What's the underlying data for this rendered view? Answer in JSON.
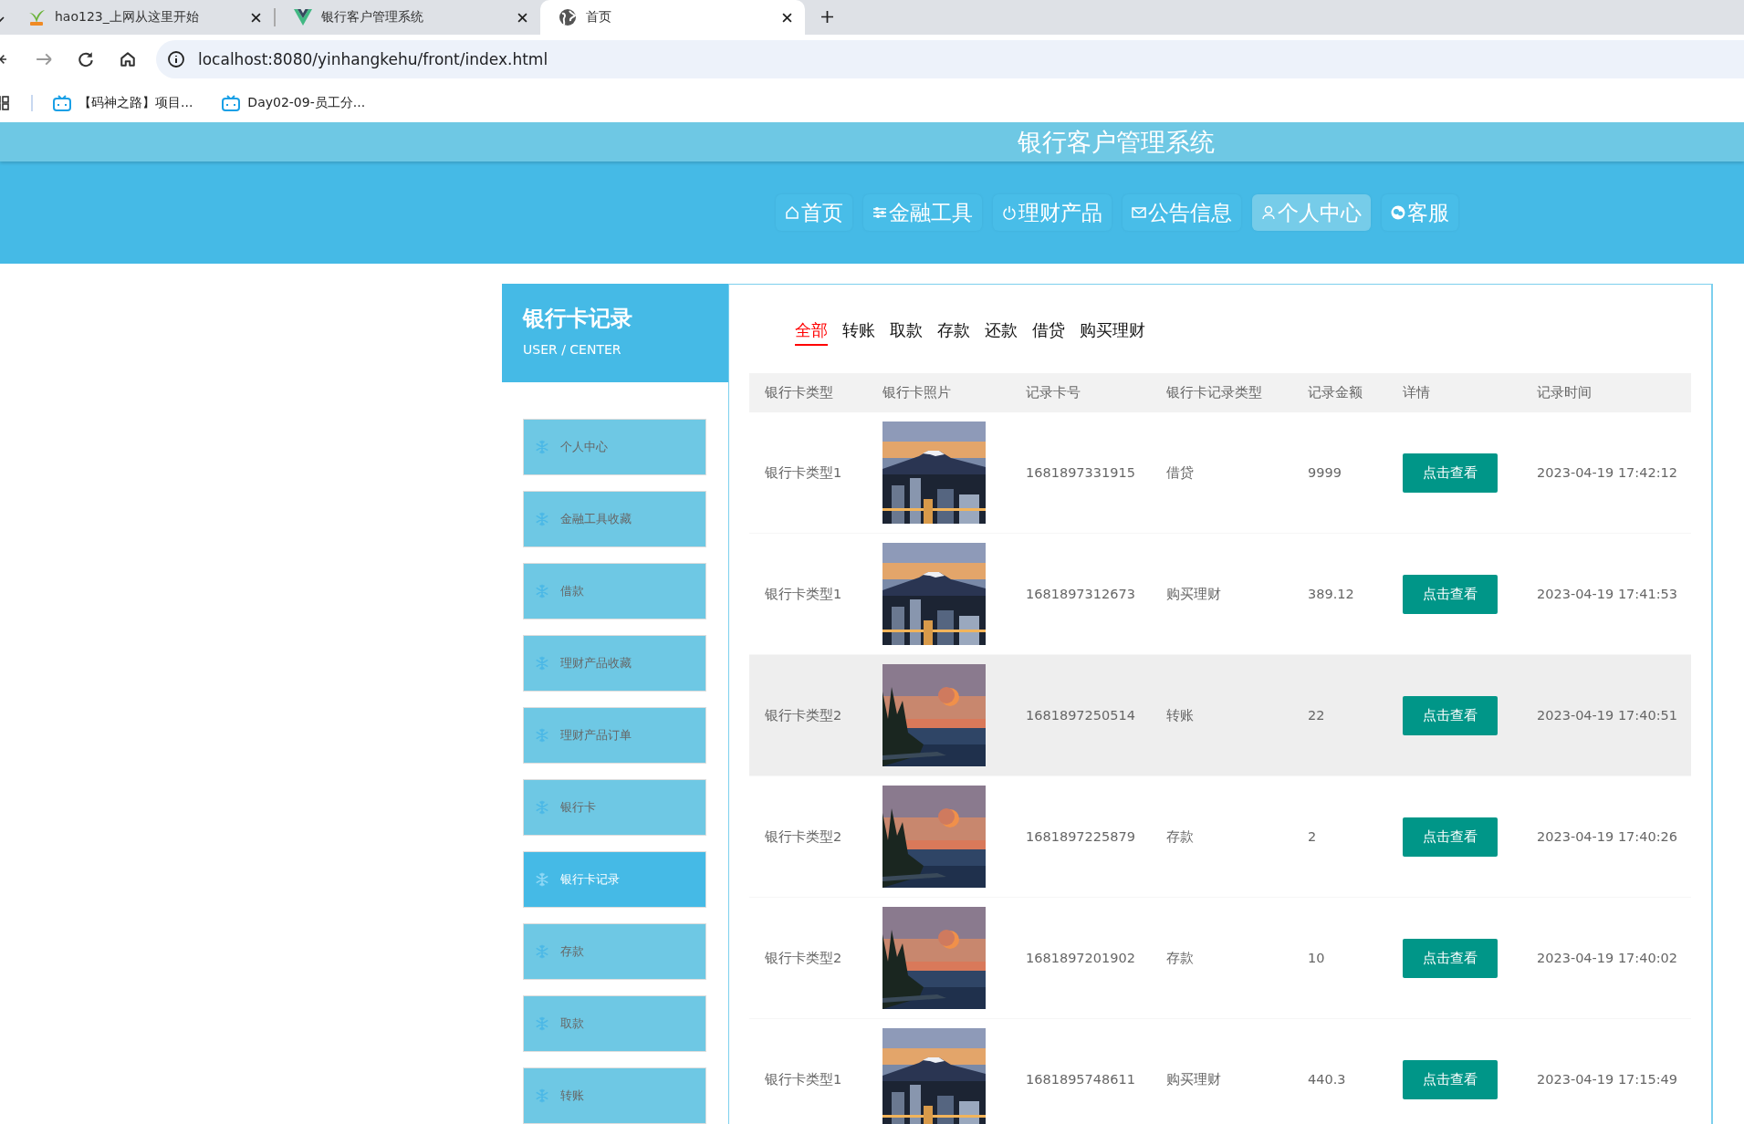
{
  "browser": {
    "tabs": [
      {
        "title": "hao123_上网从这里开始",
        "selected": false
      },
      {
        "title": "银行客户管理系统",
        "selected": false
      },
      {
        "title": "首页",
        "selected": true
      }
    ],
    "url": "localhost:8080/yinhangkehu/front/index.html",
    "bookmarks": [
      "【码神之路】项目...",
      "Day02-09-员工分..."
    ]
  },
  "site_title": "银行客户管理系统",
  "nav": [
    {
      "label": "首页",
      "selected": false
    },
    {
      "label": "金融工具",
      "selected": false
    },
    {
      "label": "理财产品",
      "selected": false
    },
    {
      "label": "公告信息",
      "selected": false
    },
    {
      "label": "个人中心",
      "selected": true
    },
    {
      "label": "客服",
      "selected": false
    }
  ],
  "sidebar": {
    "title": "银行卡记录",
    "subtitle": "USER / CENTER",
    "items": [
      {
        "label": "个人中心",
        "selected": false
      },
      {
        "label": "金融工具收藏",
        "selected": false
      },
      {
        "label": "借款",
        "selected": false
      },
      {
        "label": "理财产品收藏",
        "selected": false
      },
      {
        "label": "理财产品订单",
        "selected": false
      },
      {
        "label": "银行卡",
        "selected": false
      },
      {
        "label": "银行卡记录",
        "selected": true
      },
      {
        "label": "存款",
        "selected": false
      },
      {
        "label": "取款",
        "selected": false
      },
      {
        "label": "转账",
        "selected": false
      }
    ]
  },
  "filter_tabs": [
    {
      "label": "全部",
      "selected": true
    },
    {
      "label": "转账",
      "selected": false
    },
    {
      "label": "取款",
      "selected": false
    },
    {
      "label": "存款",
      "selected": false
    },
    {
      "label": "还款",
      "selected": false
    },
    {
      "label": "借贷",
      "selected": false
    },
    {
      "label": "购买理财",
      "selected": false
    }
  ],
  "table": {
    "columns": [
      "银行卡类型",
      "银行卡照片",
      "记录卡号",
      "银行卡记录类型",
      "记录金额",
      "详情",
      "记录时间"
    ],
    "rows": [
      {
        "card_type": "银行卡类型1",
        "card_no": "1681897331915",
        "record_type": "借贷",
        "amount": "9999",
        "detail": "点击查看",
        "time": "2023-04-19 17:42:12",
        "highlighted": false
      },
      {
        "card_type": "银行卡类型1",
        "card_no": "1681897312673",
        "record_type": "购买理财",
        "amount": "389.12",
        "detail": "点击查看",
        "time": "2023-04-19 17:41:53",
        "highlighted": false
      },
      {
        "card_type": "银行卡类型2",
        "card_no": "1681897250514",
        "record_type": "转账",
        "amount": "22",
        "detail": "点击查看",
        "time": "2023-04-19 17:40:51",
        "highlighted": true
      },
      {
        "card_type": "银行卡类型2",
        "card_no": "1681897225879",
        "record_type": "存款",
        "amount": "2",
        "detail": "点击查看",
        "time": "2023-04-19 17:40:26",
        "highlighted": false
      },
      {
        "card_type": "银行卡类型2",
        "card_no": "1681897201902",
        "record_type": "存款",
        "amount": "10",
        "detail": "点击查看",
        "time": "2023-04-19 17:40:02",
        "highlighted": false
      },
      {
        "card_type": "银行卡类型1",
        "card_no": "1681895748611",
        "record_type": "购买理财",
        "amount": "440.3",
        "detail": "点击查看",
        "time": "2023-04-19 17:15:49",
        "highlighted": false
      }
    ]
  }
}
